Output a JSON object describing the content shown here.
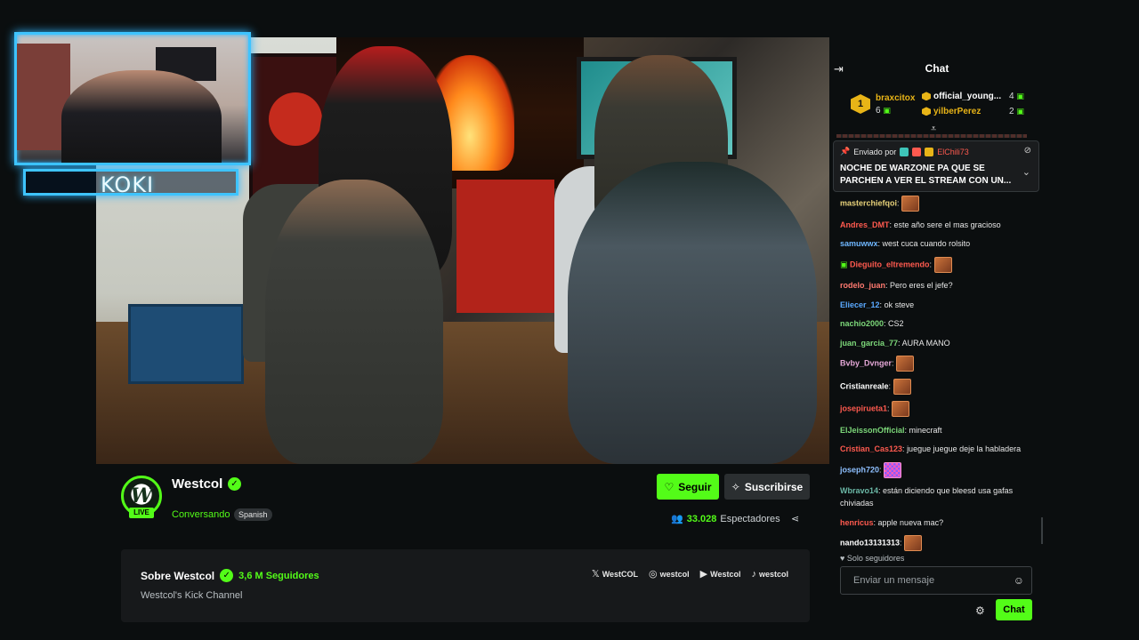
{
  "facecam": {
    "label": "KOKI"
  },
  "channel": {
    "name": "Westcol",
    "live_label": "LIVE",
    "avatar_letter": "W",
    "category": "Conversando",
    "language": "Spanish",
    "viewers_count": "33.028",
    "viewers_label": "Espectadores"
  },
  "actions": {
    "follow_label": "Seguir",
    "subscribe_label": "Suscribirse"
  },
  "about": {
    "title": "Sobre Westcol",
    "followers": "3,6 M Seguidores",
    "description": "Westcol's Kick Channel",
    "socials": [
      {
        "icon": "x-icon",
        "label": "WestCOL"
      },
      {
        "icon": "instagram-icon",
        "label": "westcol"
      },
      {
        "icon": "youtube-icon",
        "label": "Westcol"
      },
      {
        "icon": "tiktok-icon",
        "label": "westcol"
      }
    ]
  },
  "chat": {
    "title": "Chat",
    "leaderboard": [
      {
        "rank": "1",
        "name": "braxcitox",
        "count": "6",
        "color": "#e8b417"
      },
      {
        "name": "official_young...",
        "count": "4",
        "color": "#ffffff"
      },
      {
        "name": "yilberPerez",
        "count": "2",
        "color": "#e8b417"
      }
    ],
    "pinned": {
      "sent_by_label": "Enviado por",
      "sender": "ElChili73",
      "text": "NOCHE DE WARZONE PA QUE SE PARCHEN A VER EL STREAM CON UN..."
    },
    "messages": [
      {
        "user": "masterchiefqoi",
        "color": "#e8d27a",
        "text": "",
        "emote": "emote"
      },
      {
        "user": "Andres_DMT",
        "color": "#ff5a4f",
        "text": "este año sere el mas gracioso"
      },
      {
        "user": "samuwwx",
        "color": "#6fb7ff",
        "text": "west cuca cuando rolsito"
      },
      {
        "user": "Dieguito_eltremendo",
        "color": "#ff5a4f",
        "text": "",
        "emote": "emote",
        "badge": "gift"
      },
      {
        "user": "rodelo_juan",
        "color": "#ff7a70",
        "text": "Pero eres el jefe?"
      },
      {
        "user": "Eliecer_12",
        "color": "#5aa9ff",
        "text": "ok steve"
      },
      {
        "user": "nachio2000",
        "color": "#7dd87a",
        "text": "CS2"
      },
      {
        "user": "juan_garcia_77",
        "color": "#7dd87a",
        "text": "AURA MANO"
      },
      {
        "user": "Bvby_Dvnger",
        "color": "#e6a8d8",
        "text": "",
        "emote": "emote"
      },
      {
        "user": "Cristianreale",
        "color": "#ffffff",
        "text": "",
        "emote": "emote"
      },
      {
        "user": "josepirueta1",
        "color": "#ff5a4f",
        "text": "",
        "emote": "emote"
      },
      {
        "user": "ElJeissonOfficial",
        "color": "#7dd87a",
        "text": "minecraft"
      },
      {
        "user": "Cristian_Cas123",
        "color": "#ff5a4f",
        "text": "juegue juegue deje la habladera"
      },
      {
        "user": "joseph720",
        "color": "#8ec0ff",
        "text": "",
        "emote": "pix"
      },
      {
        "user": "Wbravo14",
        "color": "#6bb8a6",
        "text": "están diciendo que bleesd usa gafas chiviadas"
      },
      {
        "user": "henricus",
        "color": "#ff5a4f",
        "text": "apple nueva mac?"
      },
      {
        "user": "nando13131313",
        "color": "#ffffff",
        "text": "",
        "emote": "emote"
      }
    ],
    "followers_only": "Solo seguidores",
    "input_placeholder": "Enviar un mensaje",
    "send_label": "Chat"
  },
  "colors": {
    "accent": "#53fc18",
    "background": "#0b0e0f",
    "panel": "#17191b",
    "facecam_glow": "#3ec4ff"
  }
}
